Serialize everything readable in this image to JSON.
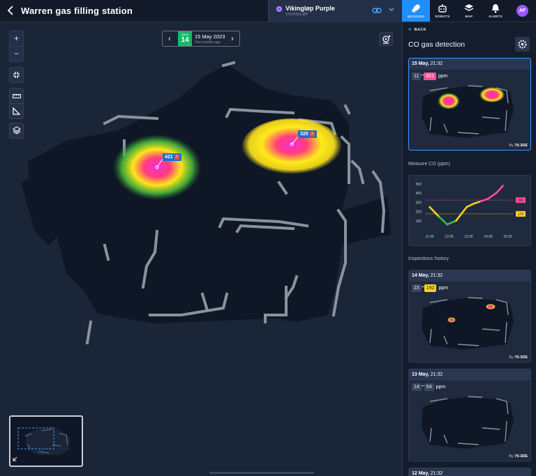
{
  "header": {
    "title": "Warren gas filling station",
    "robot_name": "Vikingløp Purple",
    "robot_sub": "VIKINGLØP"
  },
  "nav": {
    "missions": "MISSIONS",
    "robots": "ROBOTS",
    "map": "MAP",
    "alerts": "ALERTS",
    "avatar": "AF"
  },
  "map": {
    "week_label": "Week",
    "week_number": "14",
    "date": "15 May 2023",
    "date_sub": "Two months ago",
    "hotspots": [
      {
        "value": "421",
        "warn": "!"
      },
      {
        "value": "325",
        "warn": "!"
      }
    ],
    "zoom_in": "+",
    "zoom_out": "−"
  },
  "panel": {
    "back": "BACK",
    "title": "CO gas detection",
    "measure_label": "Measure CO (ppm)",
    "history_label": "Inspections history",
    "current": {
      "date": "15 May,",
      "time": "21:32",
      "min": "11",
      "max": "421",
      "unit": "ppm",
      "by_prefix": "By",
      "by": "70-3DE"
    },
    "history": [
      {
        "date": "14 May,",
        "time": "21:32",
        "min": "23",
        "max": "192",
        "unit": "ppm",
        "by_prefix": "By",
        "by": "70-3DE"
      },
      {
        "date": "13 May,",
        "time": "21:32",
        "min": "14",
        "max": "54",
        "unit": "ppm",
        "by_prefix": "By",
        "by": "70-3DE"
      },
      {
        "date": "12 May,",
        "time": "21:32"
      }
    ]
  },
  "colors": {
    "accent": "#1f8fff",
    "week_green": "#16b86b",
    "high_pink": "#ff4f9a",
    "mid_yellow": "#ffd21f",
    "low_green": "#2fc23d"
  },
  "chart_data": {
    "type": "line",
    "title": "Measure CO (ppm)",
    "categories": [
      "11.05",
      "12.05",
      "13.05",
      "14.05",
      "15.05"
    ],
    "ylim": [
      0,
      500
    ],
    "yticks": [
      100,
      200,
      300,
      400,
      500
    ],
    "series": [
      {
        "values": [
          250,
          140,
          60,
          100,
          250,
          290,
          310,
          340,
          400,
          480
        ]
      }
    ],
    "x_positions": [
      11.0,
      11.5,
      11.9,
      12.35,
      12.9,
      13.3,
      13.6,
      14.0,
      14.4,
      14.75
    ],
    "xlim": [
      10.8,
      15.3
    ],
    "thresholds": [
      {
        "label": "325",
        "value": 325,
        "color": "#ff4f9a"
      },
      {
        "label": "175",
        "value": 175,
        "color": "#ffd21f"
      }
    ]
  }
}
